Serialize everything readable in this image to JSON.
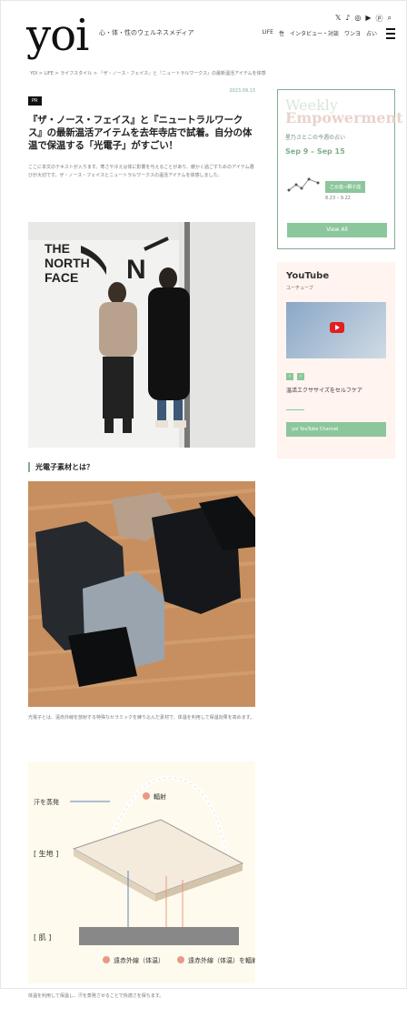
{
  "header": {
    "logo": "yoi",
    "tagline": "心・体・性のウェルネスメディア",
    "nav": [
      "LIFE",
      "性",
      "インタビュー・対談",
      "ワンヨ",
      "占い"
    ]
  },
  "breadcrumb": "YOI > LIFE > ライフスタイル > 『ザ・ノース・フェイス』と『ニュートラルワークス』の最新温活アイテムを体感",
  "article": {
    "badge": "PR",
    "date": "2023.09.13",
    "title": "『ザ・ノース・フェイス』と『ニュートラルワークス』の最新温活アイテムを去年寺店で試着。自分の体温で保温する「光電子」がすごい！",
    "lead": "ここに本文のテキストが入ります。寒さや冷えは体に影響を与えることがあり、暖かく過ごすためのアイテム選びが大切です。ザ・ノース・フェイスとニュートラルワークスの温活アイテムを体感しました。",
    "section": "光電子素材とは？",
    "caption": "光電子とは、遠赤外線を放射する特殊なセラミックを練り込んだ素材で、体温を利用して保温効果を高めます。",
    "diagram_labels": {
      "sweat": "汗を蒸発",
      "fabric": "[ 生地 ]",
      "skin": "[ 肌 ]",
      "heat": "輻射",
      "far_infrared": "遠赤外線",
      "far_infrared_body": "遠赤外線（体温）",
      "far_infrared_emit": "遠赤外線（体温）を輻射"
    },
    "footer": "体温を利用して保温し、汗を蒸発させることで快適さを保ちます。"
  },
  "sidebar": {
    "weekly_title_1": "Weekly",
    "weekly_title_2": "Empowerment",
    "weekly_sub": "星乃さとこの今週の占い",
    "weekly_date": "Sep 9 – Sep 15",
    "zodiac": "乙女座→獅子座",
    "zodiac_dates": "8.23 – 9.22",
    "weekly_button": "View All",
    "yt_title": "YouTube",
    "yt_sub": "ユーチューブ",
    "yt_desc": "温活エクササイズをセルフケア",
    "yt_button": "yoi YouTube Channel"
  }
}
